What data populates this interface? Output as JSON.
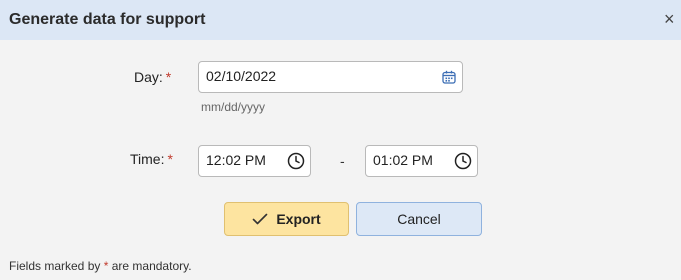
{
  "dialog": {
    "title": "Generate data for support",
    "close_glyph": "×"
  },
  "day": {
    "label": "Day:",
    "required_marker": "*",
    "value": "02/10/2022",
    "hint": "mm/dd/yyyy",
    "icon": "calendar-icon"
  },
  "time": {
    "label": "Time:",
    "required_marker": "*",
    "start_value": "12:02 PM",
    "separator": "-",
    "end_value": "01:02 PM",
    "icon": "clock-icon"
  },
  "buttons": {
    "export_label": "Export",
    "export_icon": "checkmark-icon",
    "cancel_label": "Cancel"
  },
  "footer": {
    "prefix": "Fields marked by",
    "marker": "*",
    "suffix": "are mandatory."
  },
  "colors": {
    "title_bar": "#dce7f5",
    "required": "#c0392b",
    "export_button": "#fde4a0",
    "cancel_button": "#dde8f6"
  }
}
